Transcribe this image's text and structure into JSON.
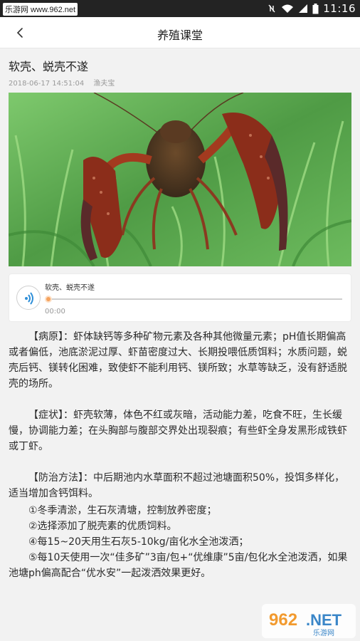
{
  "status_bar": {
    "watermark": "乐游网 www.962.net",
    "time": "11:16"
  },
  "nav": {
    "title": "养殖课堂",
    "back_icon": "chevron-left-icon"
  },
  "article": {
    "title": "软壳、蜕壳不遂",
    "date": "2018-06-17 14:51:04",
    "author": "渔夫宝",
    "image_alt": "crayfish on grass"
  },
  "audio": {
    "title": "软壳、蜕壳不遂",
    "time": "00:00",
    "progress": 0
  },
  "sections": {
    "p1": "【病原】：虾体缺钙等多种矿物元素及各种其他微量元素；pH值长期偏高或者偏低，池底淤泥过厚、虾苗密度过大、长期投喂低质饵料；水质问题，蜕壳后钙、镁转化困难，致使虾不能利用钙、镁所致；水草等缺乏，没有舒适脱壳的场所。",
    "p2": "【症状】：虾壳软薄，体色不红或灰暗，活动能力差，吃食不旺，生长缓慢，协调能力差；在头胸部与腹部交界处出现裂痕；有些虾全身发黑形成铁虾或丁虾。",
    "p3": "【防治方法】：中后期池内水草面积不超过池塘面积50%，投饵多样化，适当增加含钙饵料。",
    "items": [
      "①冬季清淤，生石灰清塘，控制放养密度；",
      "②选择添加了脱壳素的优质饲料。",
      "④每15~20天用生石灰5-10kg/亩化水全池泼洒；",
      "⑤每10天使用一次“佳多矿”3亩/包+“优维康”5亩/包化水全池泼洒，如果池塘ph偏高配合“优水安”一起泼洒效果更好。"
    ]
  },
  "colors": {
    "accent": "#f5a25d",
    "play_icon": "#2f8fd8",
    "statusbar": "#232323"
  }
}
